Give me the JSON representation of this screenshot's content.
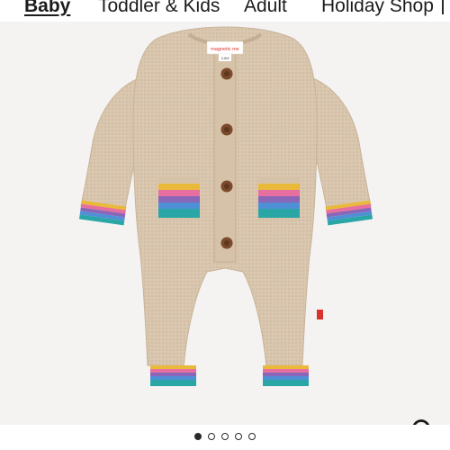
{
  "nav": {
    "items": [
      {
        "label": "Baby",
        "active": true
      },
      {
        "label": "Toddler & Kids",
        "active": false
      },
      {
        "label": "Adult",
        "active": false
      },
      {
        "label": "Holiday Shop",
        "active": false
      }
    ]
  },
  "product_image": {
    "garment_color": "#d9c6ae",
    "brand_label": "magnetic me",
    "size_label": "3-6M",
    "stripe_colors": [
      "#e9b93a",
      "#e76fa0",
      "#8a66b8",
      "#4f8fd6",
      "#2aa6a6"
    ],
    "button_color": "#7a4a2a",
    "flag_color": "#d9342b",
    "background_color": "#f4f3f2"
  },
  "search": {
    "icon": "magnifier-icon"
  },
  "carousel": {
    "count": 5,
    "active_index": 0
  }
}
